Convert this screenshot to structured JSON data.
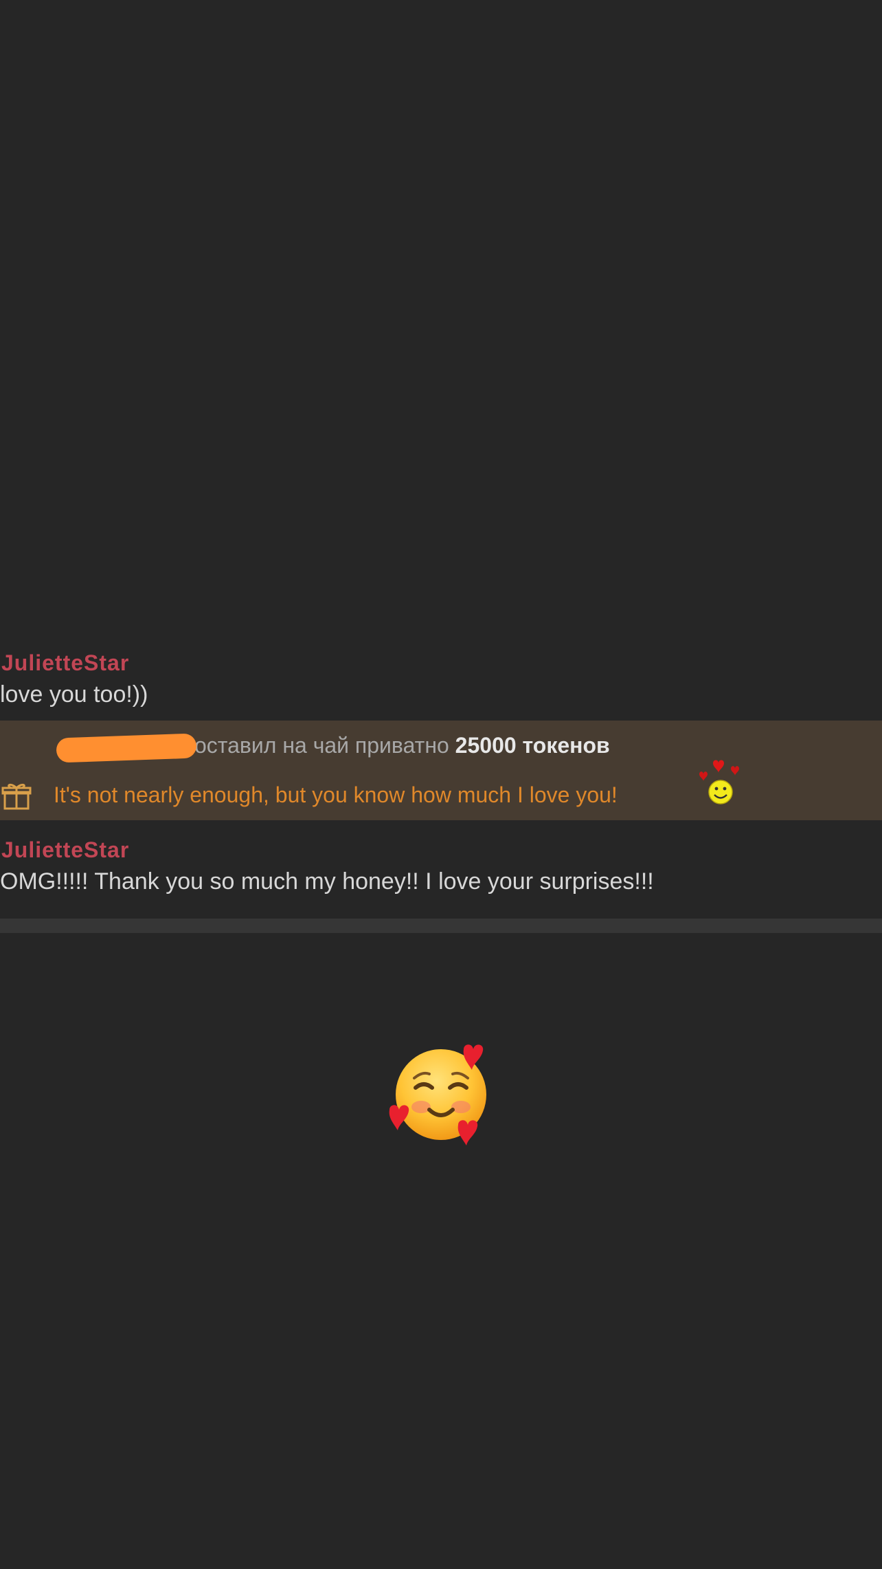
{
  "messages": [
    {
      "sender": "JulietteStar",
      "text": "love you too!))"
    },
    {
      "sender": "JulietteStar",
      "text": "OMG!!!!! Thank you so much my honey!! I love your surprises!!!"
    }
  ],
  "tip": {
    "user": "",
    "action": "оставил на чай приватно",
    "amount": "25000 токенов",
    "note": "It's not nearly enough, but you know how much I love you!",
    "user_redacted": true
  },
  "icons": {
    "gift": "gift-icon",
    "tip_emoji": "smiley-with-hearts-icon",
    "reaction_emoji": "smiling-face-with-hearts-emoji"
  },
  "colors": {
    "background": "#262626",
    "sender": "#c24655",
    "message_text": "#d8d8d8",
    "tip_background": "#473c31",
    "tip_note": "#e0882a",
    "redaction": "#ff8f30"
  }
}
